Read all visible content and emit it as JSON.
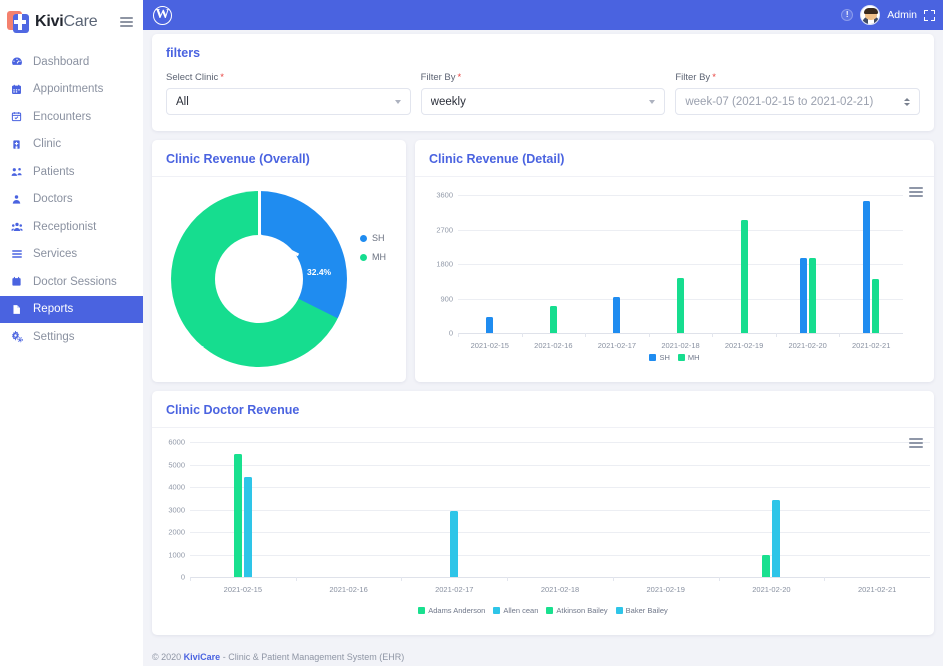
{
  "sidebar": {
    "brand": {
      "part1": "Kivi",
      "part2": "Care"
    },
    "items": [
      {
        "label": "Dashboard",
        "icon": "speedometer-icon",
        "active": false
      },
      {
        "label": "Appointments",
        "icon": "calendar-icon",
        "active": false
      },
      {
        "label": "Encounters",
        "icon": "calendar-check-icon",
        "active": false
      },
      {
        "label": "Clinic",
        "icon": "hospital-icon",
        "active": false
      },
      {
        "label": "Patients",
        "icon": "patients-icon",
        "active": false
      },
      {
        "label": "Doctors",
        "icon": "doctor-icon",
        "active": false
      },
      {
        "label": "Receptionist",
        "icon": "users-icon",
        "active": false
      },
      {
        "label": "Services",
        "icon": "list-icon",
        "active": false
      },
      {
        "label": "Doctor Sessions",
        "icon": "session-calendar-icon",
        "active": false
      },
      {
        "label": "Reports",
        "icon": "document-icon",
        "active": true
      },
      {
        "label": "Settings",
        "icon": "gear-icon",
        "active": false
      }
    ]
  },
  "topbar": {
    "wp_logo": "W",
    "info_badge": "!",
    "admin_label": "Admin",
    "fullscreen_icon": "expand-icon"
  },
  "filters": {
    "title": "filters",
    "clinic": {
      "label": "Select Clinic",
      "required": "*",
      "value": "All"
    },
    "filter_by_period": {
      "label": "Filter By",
      "required": "*",
      "value": "weekly"
    },
    "filter_by_week": {
      "label": "Filter By",
      "required": "*",
      "placeholder": "week-07 (2021-02-15 to 2021-02-21)"
    }
  },
  "cards": {
    "overall_title": "Clinic Revenue (Overall)",
    "detail_title": "Clinic Revenue (Detail)",
    "doctor_title": "Clinic Doctor Revenue"
  },
  "colors": {
    "brand_blue": "#4a63e0",
    "series_sh": "#1f8cf0",
    "series_mh": "#16dd8f",
    "doctor_green": "#19e08f",
    "doctor_cyan": "#2ec5e8"
  },
  "chart_data": [
    {
      "type": "pie",
      "title": "Clinic Revenue (Overall)",
      "labels": [
        "SH",
        "MH"
      ],
      "values": [
        32.4,
        67.6
      ],
      "value_labels": [
        "32.4%",
        "67.6%"
      ],
      "colors": [
        "#1f8cf0",
        "#16dd8f"
      ],
      "legend_position": "right",
      "donut": true
    },
    {
      "type": "bar",
      "title": "Clinic Revenue (Detail)",
      "categories": [
        "2021-02-15",
        "2021-02-16",
        "2021-02-17",
        "2021-02-18",
        "2021-02-19",
        "2021-02-20",
        "2021-02-21"
      ],
      "series": [
        {
          "name": "SH",
          "color": "#1f8cf0",
          "values": [
            430,
            0,
            930,
            0,
            0,
            1950,
            3450
          ]
        },
        {
          "name": "MH",
          "color": "#16dd8f",
          "values": [
            0,
            700,
            0,
            1430,
            2950,
            1960,
            1400
          ]
        }
      ],
      "ylim": [
        0,
        3600
      ],
      "yticks": [
        0,
        900,
        1800,
        2700,
        3600
      ],
      "xlabel": "",
      "ylabel": "",
      "grid": true,
      "legend_position": "bottom"
    },
    {
      "type": "bar",
      "title": "Clinic Doctor Revenue",
      "categories": [
        "2021-02-15",
        "2021-02-16",
        "2021-02-17",
        "2021-02-18",
        "2021-02-19",
        "2021-02-20",
        "2021-02-21"
      ],
      "series": [
        {
          "name": "Adams Anderson",
          "color": "#19e08f",
          "values": [
            5450,
            0,
            0,
            0,
            0,
            0,
            0
          ]
        },
        {
          "name": "Allen cean",
          "color": "#2ec5e8",
          "values": [
            4430,
            0,
            0,
            0,
            0,
            0,
            0
          ]
        },
        {
          "name": "Atkinson Bailey",
          "color": "#19e08f",
          "values": [
            0,
            0,
            0,
            0,
            0,
            960,
            0
          ]
        },
        {
          "name": "Baker Bailey",
          "color": "#2ec5e8",
          "values": [
            0,
            0,
            2940,
            0,
            0,
            3440,
            0
          ]
        }
      ],
      "ylim": [
        0,
        6000
      ],
      "yticks": [
        0,
        1000,
        2000,
        3000,
        4000,
        5000,
        6000
      ],
      "xlabel": "",
      "ylabel": "",
      "grid": true,
      "legend_position": "bottom"
    }
  ],
  "footer": {
    "copyright": "© 2020",
    "brand": "KiviCare",
    "tagline": " - Clinic & Patient Management System (EHR)"
  }
}
